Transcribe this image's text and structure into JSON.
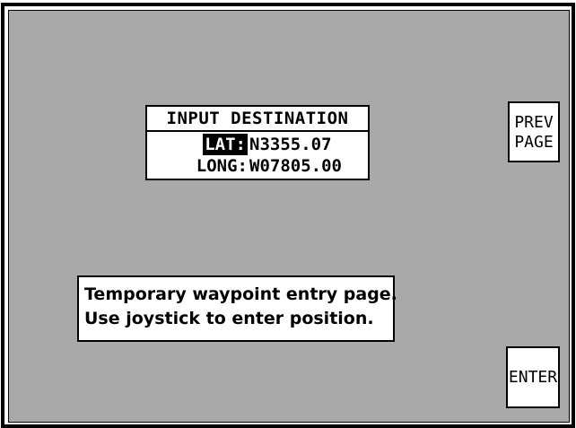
{
  "destination": {
    "title": "INPUT DESTINATION",
    "lat_label": "LAT:",
    "lat_value": "N3355.07",
    "long_label": "LONG:",
    "long_value": "W07805.00"
  },
  "message": {
    "line1": "Temporary waypoint entry page.",
    "line2": "Use joystick to enter position."
  },
  "buttons": {
    "prev_page_line1": "PREV",
    "prev_page_line2": "PAGE",
    "enter": "ENTER"
  },
  "colors": {
    "panel_background": "#a9a9a9",
    "box_background": "#ffffff",
    "frame": "#000000",
    "highlight": "#000000"
  }
}
